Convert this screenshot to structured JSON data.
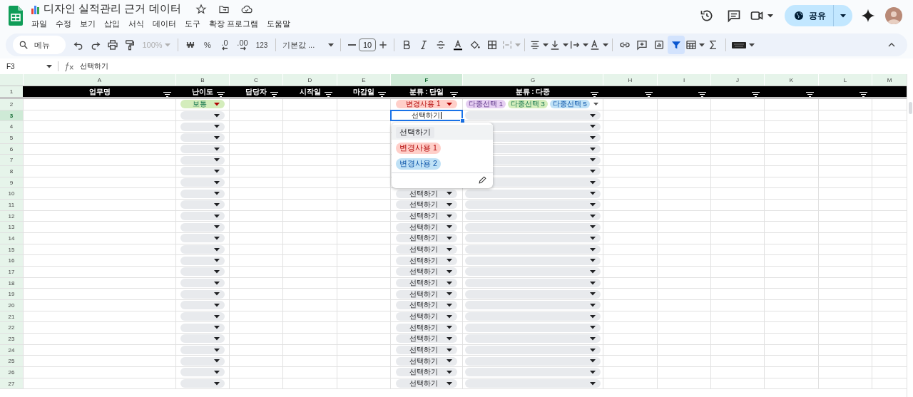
{
  "document": {
    "title": "디자인 실적관리 근거 데이터",
    "menus": [
      "파일",
      "수정",
      "보기",
      "삽입",
      "서식",
      "데이터",
      "도구",
      "확장 프로그램",
      "도움말"
    ],
    "share": "공유"
  },
  "toolbar": {
    "search_placeholder": "메뉴",
    "zoom": "100%",
    "currency": "₩",
    "percent": "%",
    "decimal_decrease": ".0",
    "decimal_increase": ".00",
    "number_format": "123",
    "font": "기본값 ...",
    "font_size": "10",
    "filter_active": true
  },
  "formula_bar": {
    "cell": "F3",
    "value": "선택하기"
  },
  "sheet": {
    "columns": [
      {
        "letter": "A",
        "selected": false
      },
      {
        "letter": "B",
        "selected": false
      },
      {
        "letter": "C",
        "selected": false
      },
      {
        "letter": "D",
        "selected": false
      },
      {
        "letter": "E",
        "selected": false
      },
      {
        "letter": "F",
        "selected": true
      },
      {
        "letter": "G",
        "selected": false
      },
      {
        "letter": "H",
        "selected": false
      },
      {
        "letter": "I",
        "selected": false
      },
      {
        "letter": "J",
        "selected": false
      },
      {
        "letter": "K",
        "selected": false
      },
      {
        "letter": "L",
        "selected": false
      },
      {
        "letter": "M",
        "selected": false
      }
    ],
    "header_row": {
      "number": "1",
      "cells": [
        {
          "label": "업무명",
          "filter": true
        },
        {
          "label": "난이도",
          "filter": true
        },
        {
          "label": "담당자",
          "filter": true
        },
        {
          "label": "시작일",
          "filter": true
        },
        {
          "label": "마감일",
          "filter": true
        },
        {
          "label": "분류 : 단일",
          "filter": true
        },
        {
          "label": "분류 : 다중",
          "filter": true
        },
        {
          "filter": true
        },
        {
          "filter": true
        },
        {
          "filter": true
        },
        {
          "filter": true
        },
        {
          "filter": true
        },
        {
          "filter": false
        }
      ]
    },
    "rows": [
      {
        "number": "2",
        "selected": false,
        "difficulty": {
          "kind": "chip",
          "text": "보통",
          "color": "#d4edbc"
        },
        "category": {
          "kind": "chip",
          "text": "변경사용 1",
          "color": "#ffcfc9"
        },
        "multi": {
          "kind": "chips",
          "chips": [
            {
              "text": "다중선택 1",
              "color": "#e6cff2"
            },
            {
              "text": "다중선택 3",
              "color": "#d4edbc"
            },
            {
              "text": "다중선택 5",
              "color": "#bfe1f6"
            }
          ]
        }
      },
      {
        "number": "3",
        "selected": true,
        "difficulty": {
          "kind": "empty"
        },
        "category": {
          "kind": "editing",
          "text": "선택하기"
        },
        "multi": {
          "kind": "empty"
        }
      },
      {
        "number": "4",
        "selected": false,
        "difficulty": {
          "kind": "empty"
        },
        "multi": {
          "kind": "empty"
        }
      },
      {
        "number": "5",
        "selected": false,
        "difficulty": {
          "kind": "empty"
        },
        "multi": {
          "kind": "empty"
        }
      },
      {
        "number": "6",
        "selected": false,
        "difficulty": {
          "kind": "empty"
        },
        "multi": {
          "kind": "empty"
        }
      },
      {
        "number": "7",
        "selected": false,
        "difficulty": {
          "kind": "empty"
        },
        "multi": {
          "kind": "empty"
        }
      },
      {
        "number": "8",
        "selected": false,
        "difficulty": {
          "kind": "empty"
        },
        "multi": {
          "kind": "empty"
        }
      },
      {
        "number": "9",
        "selected": false,
        "difficulty": {
          "kind": "empty"
        },
        "multi": {
          "kind": "empty"
        }
      },
      {
        "number": "10",
        "selected": false,
        "difficulty": {
          "kind": "empty"
        },
        "category": {
          "kind": "chip",
          "text": "선택하기"
        },
        "multi": {
          "kind": "empty"
        }
      },
      {
        "number": "11",
        "selected": false,
        "difficulty": {
          "kind": "empty"
        },
        "category": {
          "kind": "chip",
          "text": "선택하기"
        },
        "multi": {
          "kind": "empty"
        }
      },
      {
        "number": "12",
        "selected": false,
        "difficulty": {
          "kind": "empty"
        },
        "category": {
          "kind": "chip",
          "text": "선택하기"
        },
        "multi": {
          "kind": "empty"
        }
      },
      {
        "number": "13",
        "selected": false,
        "difficulty": {
          "kind": "empty"
        },
        "category": {
          "kind": "chip",
          "text": "선택하기"
        },
        "multi": {
          "kind": "empty"
        }
      },
      {
        "number": "14",
        "selected": false,
        "difficulty": {
          "kind": "empty"
        },
        "category": {
          "kind": "chip",
          "text": "선택하기"
        },
        "multi": {
          "kind": "empty"
        }
      },
      {
        "number": "15",
        "selected": false,
        "difficulty": {
          "kind": "empty"
        },
        "category": {
          "kind": "chip",
          "text": "선택하기"
        },
        "multi": {
          "kind": "empty"
        }
      },
      {
        "number": "16",
        "selected": false,
        "difficulty": {
          "kind": "empty"
        },
        "category": {
          "kind": "chip",
          "text": "선택하기"
        },
        "multi": {
          "kind": "empty"
        }
      },
      {
        "number": "17",
        "selected": false,
        "difficulty": {
          "kind": "empty"
        },
        "category": {
          "kind": "chip",
          "text": "선택하기"
        },
        "multi": {
          "kind": "empty"
        }
      },
      {
        "number": "18",
        "selected": false,
        "difficulty": {
          "kind": "empty"
        },
        "category": {
          "kind": "chip",
          "text": "선택하기"
        },
        "multi": {
          "kind": "empty"
        }
      },
      {
        "number": "19",
        "selected": false,
        "difficulty": {
          "kind": "empty"
        },
        "category": {
          "kind": "chip",
          "text": "선택하기"
        },
        "multi": {
          "kind": "empty"
        }
      },
      {
        "number": "20",
        "selected": false,
        "difficulty": {
          "kind": "empty"
        },
        "category": {
          "kind": "chip",
          "text": "선택하기"
        },
        "multi": {
          "kind": "empty"
        }
      },
      {
        "number": "21",
        "selected": false,
        "difficulty": {
          "kind": "empty"
        },
        "category": {
          "kind": "chip",
          "text": "선택하기"
        },
        "multi": {
          "kind": "empty"
        }
      },
      {
        "number": "22",
        "selected": false,
        "difficulty": {
          "kind": "empty"
        },
        "category": {
          "kind": "chip",
          "text": "선택하기"
        },
        "multi": {
          "kind": "empty"
        }
      },
      {
        "number": "23",
        "selected": false,
        "difficulty": {
          "kind": "empty"
        },
        "category": {
          "kind": "chip",
          "text": "선택하기"
        },
        "multi": {
          "kind": "empty"
        }
      },
      {
        "number": "24",
        "selected": false,
        "difficulty": {
          "kind": "empty"
        },
        "category": {
          "kind": "chip",
          "text": "선택하기"
        },
        "multi": {
          "kind": "empty"
        }
      },
      {
        "number": "25",
        "selected": false,
        "difficulty": {
          "kind": "empty"
        },
        "category": {
          "kind": "chip",
          "text": "선택하기"
        },
        "multi": {
          "kind": "empty"
        }
      },
      {
        "number": "26",
        "selected": false,
        "difficulty": {
          "kind": "empty"
        },
        "category": {
          "kind": "chip",
          "text": "선택하기"
        },
        "multi": {
          "kind": "empty"
        }
      },
      {
        "number": "27",
        "selected": false,
        "difficulty": {
          "kind": "empty"
        },
        "category": {
          "kind": "chip",
          "text": "선택하기"
        },
        "multi": {
          "kind": "empty"
        }
      }
    ],
    "dropdown": {
      "options": [
        {
          "text": "선택하기",
          "color": "#e8eaed",
          "selected": true
        },
        {
          "text": "변경사용 1",
          "color": "#ffcfc9",
          "selected": false
        },
        {
          "text": "변경사용 2",
          "color": "#bfe1f6",
          "selected": false
        }
      ]
    }
  }
}
